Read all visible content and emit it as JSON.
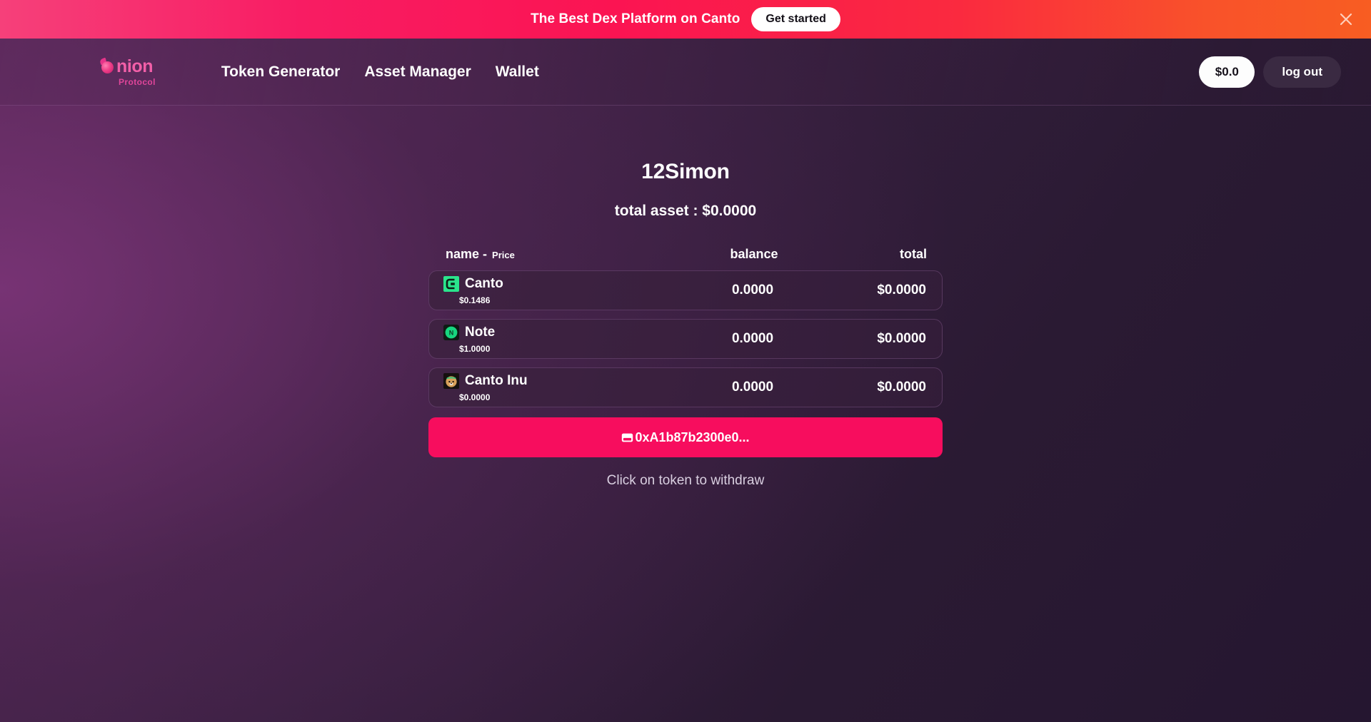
{
  "banner": {
    "text": "The Best Dex Platform on Canto",
    "cta_label": "Get started",
    "close_icon": "close-icon",
    "gradient_start": "#f6407a",
    "gradient_end": "#f85d22"
  },
  "header": {
    "brand_name": "nion",
    "brand_sub": "Protocol",
    "brand_color": "#f25fa8",
    "nav": [
      {
        "label": "Token Generator"
      },
      {
        "label": "Asset Manager"
      },
      {
        "label": "Wallet"
      }
    ],
    "balance_label": "$0.0",
    "logout_label": "log out"
  },
  "main": {
    "account_name": "12Simon",
    "total_asset": "total asset : $0.0000",
    "table_headers": {
      "name": "name -",
      "price": "Price",
      "balance": "balance",
      "total": "total"
    },
    "tokens": [
      {
        "name": "Canto",
        "price": "$0.1486",
        "balance": "0.0000",
        "total": "$0.0000",
        "icon": "canto-token-icon",
        "icon_color": "#2ae58c"
      },
      {
        "name": "Note",
        "price": "$1.0000",
        "balance": "0.0000",
        "total": "$0.0000",
        "icon": "note-token-icon",
        "icon_color": "#17d67f"
      },
      {
        "name": "Canto Inu",
        "price": "$0.0000",
        "balance": "0.0000",
        "total": "$0.0000",
        "icon": "canto-inu-token-icon",
        "icon_color": "#2fc07a"
      }
    ],
    "address_label": "0xA1b87b2300e0...",
    "address_icon": "wallet-icon",
    "address_button_color": "#f70d5e",
    "withdraw_hint": "Click on token to withdraw"
  }
}
